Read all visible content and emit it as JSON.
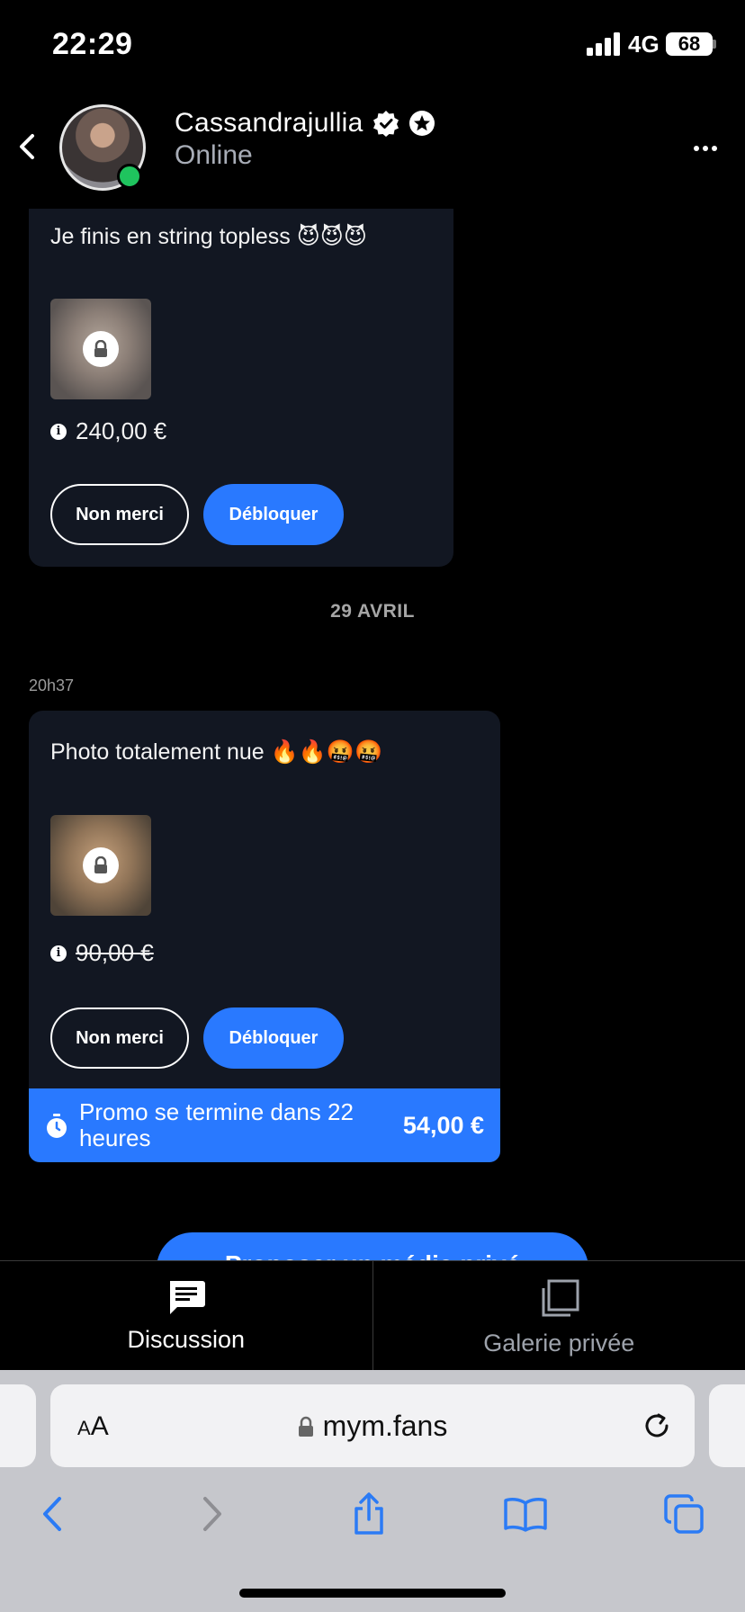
{
  "status_bar": {
    "time": "22:29",
    "network": "4G",
    "battery": "68"
  },
  "header": {
    "contact_name": "Cassandrajullia",
    "status": "Online"
  },
  "messages": [
    {
      "text": "Je finis en string topless 😈😈😈",
      "price": "240,00 €",
      "decline_label": "Non merci",
      "unlock_label": "Débloquer"
    },
    {
      "time": "20h37",
      "text": "Photo totalement nue 🔥🔥🤬🤬",
      "price": "90,00 €",
      "decline_label": "Non merci",
      "unlock_label": "Débloquer",
      "promo_text": "Promo se termine dans 22 heures",
      "promo_price": "54,00 €"
    }
  ],
  "date_separator": "29 AVRIL",
  "cta_partial": "Proposer un média privé",
  "tabs": [
    {
      "label": "Discussion",
      "icon": "chat-icon",
      "active": true
    },
    {
      "label": "Galerie privée",
      "icon": "gallery-icon",
      "active": false
    }
  ],
  "browser": {
    "text_size_label_small": "A",
    "text_size_label_big": "A",
    "url": "mym.fans"
  },
  "colors": {
    "accent": "#2979ff",
    "bubble": "#121722",
    "online": "#1fc45e"
  }
}
